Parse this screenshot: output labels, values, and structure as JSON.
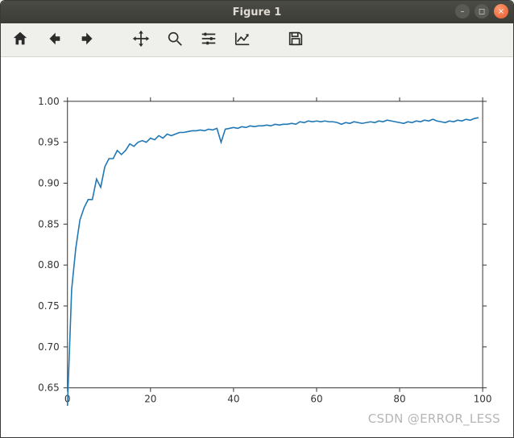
{
  "window": {
    "title": "Figure 1"
  },
  "toolbar": {
    "home": "Home",
    "back": "Back",
    "forward": "Forward",
    "pan": "Pan",
    "zoom": "Zoom",
    "configure": "Configure subplots",
    "edit": "Edit axis",
    "save": "Save"
  },
  "watermark": "CSDN @ERROR_LESS",
  "chart_data": {
    "type": "line",
    "x": [
      0,
      1,
      2,
      3,
      4,
      5,
      6,
      7,
      8,
      9,
      10,
      11,
      12,
      13,
      14,
      15,
      16,
      17,
      18,
      19,
      20,
      21,
      22,
      23,
      24,
      25,
      26,
      27,
      28,
      29,
      30,
      31,
      32,
      33,
      34,
      35,
      36,
      37,
      38,
      39,
      40,
      41,
      42,
      43,
      44,
      45,
      46,
      47,
      48,
      49,
      50,
      51,
      52,
      53,
      54,
      55,
      56,
      57,
      58,
      59,
      60,
      61,
      62,
      63,
      64,
      65,
      66,
      67,
      68,
      69,
      70,
      71,
      72,
      73,
      74,
      75,
      76,
      77,
      78,
      79,
      80,
      81,
      82,
      83,
      84,
      85,
      86,
      87,
      88,
      89,
      90,
      91,
      92,
      93,
      94,
      95,
      96,
      97,
      98,
      99
    ],
    "y": [
      0.628,
      0.77,
      0.82,
      0.855,
      0.87,
      0.88,
      0.88,
      0.905,
      0.895,
      0.92,
      0.93,
      0.93,
      0.94,
      0.935,
      0.94,
      0.948,
      0.945,
      0.95,
      0.952,
      0.95,
      0.955,
      0.953,
      0.958,
      0.955,
      0.96,
      0.958,
      0.96,
      0.962,
      0.962,
      0.963,
      0.964,
      0.964,
      0.965,
      0.964,
      0.966,
      0.965,
      0.967,
      0.95,
      0.966,
      0.967,
      0.968,
      0.967,
      0.969,
      0.968,
      0.97,
      0.969,
      0.97,
      0.97,
      0.971,
      0.97,
      0.972,
      0.971,
      0.972,
      0.972,
      0.973,
      0.972,
      0.975,
      0.974,
      0.976,
      0.975,
      0.976,
      0.975,
      0.976,
      0.975,
      0.975,
      0.974,
      0.972,
      0.974,
      0.973,
      0.975,
      0.974,
      0.973,
      0.974,
      0.975,
      0.974,
      0.976,
      0.975,
      0.977,
      0.976,
      0.975,
      0.974,
      0.973,
      0.975,
      0.974,
      0.976,
      0.975,
      0.977,
      0.976,
      0.978,
      0.976,
      0.975,
      0.974,
      0.976,
      0.975,
      0.977,
      0.976,
      0.978,
      0.977,
      0.979,
      0.98
    ],
    "title": "",
    "xlabel": "",
    "ylabel": "",
    "xlim": [
      0,
      100
    ],
    "ylim": [
      0.65,
      1.0
    ],
    "xticks": [
      0,
      20,
      40,
      60,
      80,
      100
    ],
    "yticks": [
      0.65,
      0.7,
      0.75,
      0.8,
      0.85,
      0.9,
      0.95,
      1.0
    ],
    "ytick_labels": [
      "0.65",
      "0.70",
      "0.75",
      "0.80",
      "0.85",
      "0.90",
      "0.95",
      "1.00"
    ],
    "grid": false,
    "line_color": "#1f77b4"
  }
}
